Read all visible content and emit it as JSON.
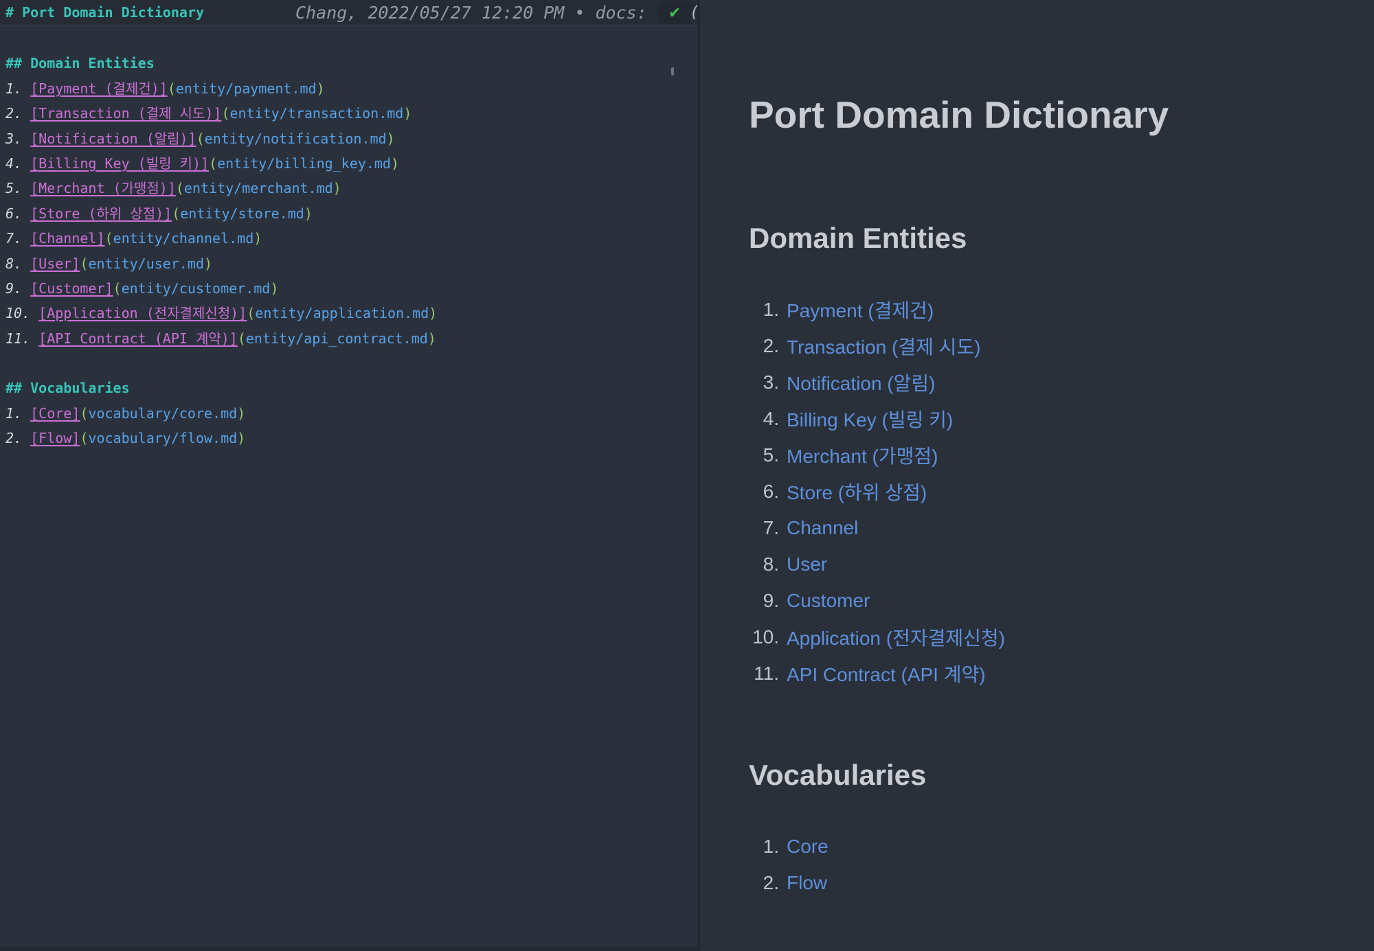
{
  "colors": {
    "left_bg": "#2b313c",
    "header_bg": "#262b34",
    "right_bg": "#2a3039",
    "divider": "#1d222a",
    "teal_heading": "#38c5ba",
    "magenta_link": "#cb6fd6",
    "url_blue": "#56a2e8",
    "paren_green": "#9ac96e",
    "number_gray": "#d4d7dc",
    "meta_gray": "#949aa5",
    "check_green": "#3fbf4e",
    "preview_heading": "#c9cdd3",
    "preview_number": "#bfc3c9",
    "preview_link": "#5d8fdc"
  },
  "editor": {
    "title_line": {
      "text": "# Port Domain Dictionary",
      "meta": "Chang, 2022/05/27 12:20 PM • docs:",
      "check_glyph": "✔",
      "clipped": "("
    },
    "syntax": {
      "open": "(",
      "close": ")"
    },
    "lines": [
      {
        "type": "blank"
      },
      {
        "type": "heading",
        "text": "## Domain Entities"
      },
      {
        "type": "link",
        "num": "1.",
        "label": "[Payment (결제건)]",
        "url": "entity/payment.md"
      },
      {
        "type": "link",
        "num": "2.",
        "label": "[Transaction (결제 시도)]",
        "url": "entity/transaction.md"
      },
      {
        "type": "link",
        "num": "3.",
        "label": "[Notification (알림)]",
        "url": "entity/notification.md"
      },
      {
        "type": "link",
        "num": "4.",
        "label": "[Billing Key (빌링 키)]",
        "url": "entity/billing_key.md"
      },
      {
        "type": "link",
        "num": "5.",
        "label": "[Merchant (가맹점)]",
        "url": "entity/merchant.md"
      },
      {
        "type": "link",
        "num": "6.",
        "label": "[Store (하위 상점)]",
        "url": "entity/store.md"
      },
      {
        "type": "link",
        "num": "7.",
        "label": "[Channel]",
        "url": "entity/channel.md"
      },
      {
        "type": "link",
        "num": "8.",
        "label": "[User]",
        "url": "entity/user.md"
      },
      {
        "type": "link",
        "num": "9.",
        "label": "[Customer]",
        "url": "entity/customer.md"
      },
      {
        "type": "link",
        "num": "10.",
        "label": "[Application (전자결제신청)]",
        "url": "entity/application.md"
      },
      {
        "type": "link",
        "num": "11.",
        "label": "[API Contract (API 계약)]",
        "url": "entity/api_contract.md"
      },
      {
        "type": "blank"
      },
      {
        "type": "heading",
        "text": "## Vocabularies"
      },
      {
        "type": "link",
        "num": "1.",
        "label": "[Core]",
        "url": "vocabulary/core.md"
      },
      {
        "type": "link",
        "num": "2.",
        "label": "[Flow]",
        "url": "vocabulary/flow.md"
      }
    ]
  },
  "preview": {
    "title": "Port Domain Dictionary",
    "sections": [
      {
        "heading": "Domain Entities",
        "items": [
          {
            "num": "1.",
            "label": "Payment (결제건)"
          },
          {
            "num": "2.",
            "label": "Transaction (결제 시도)"
          },
          {
            "num": "3.",
            "label": "Notification (알림)"
          },
          {
            "num": "4.",
            "label": "Billing Key (빌링 키)"
          },
          {
            "num": "5.",
            "label": "Merchant (가맹점)"
          },
          {
            "num": "6.",
            "label": "Store (하위 상점)"
          },
          {
            "num": "7.",
            "label": "Channel"
          },
          {
            "num": "8.",
            "label": "User"
          },
          {
            "num": "9.",
            "label": "Customer"
          },
          {
            "num": "10.",
            "label": "Application (전자결제신청)"
          },
          {
            "num": "11.",
            "label": "API Contract (API 계약)"
          }
        ]
      },
      {
        "heading": "Vocabularies",
        "items": [
          {
            "num": "1.",
            "label": "Core"
          },
          {
            "num": "2.",
            "label": "Flow"
          }
        ]
      }
    ]
  }
}
